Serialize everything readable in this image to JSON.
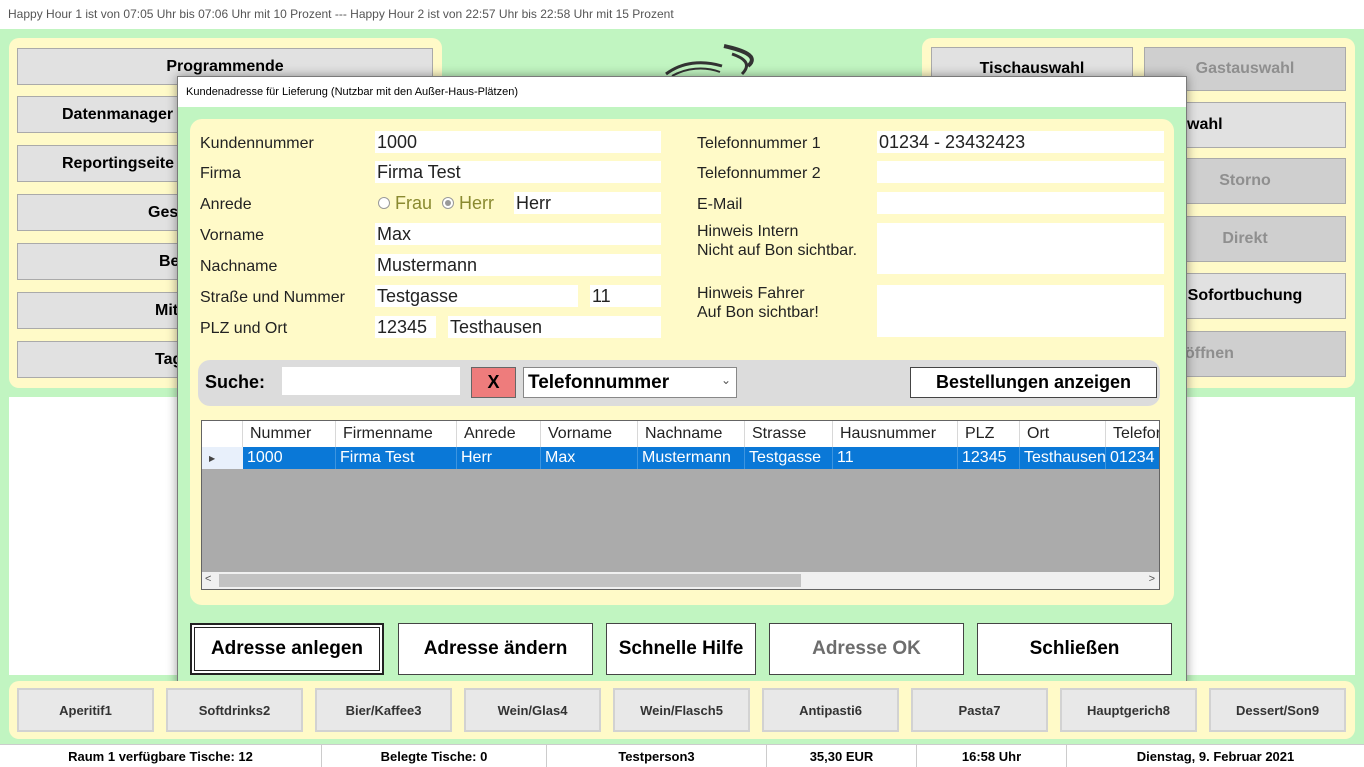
{
  "ticker": "Happy Hour 1 ist von 07:05 Uhr bis 07:06 Uhr mit 10 Prozent --- Happy Hour 2 ist von 22:57 Uhr bis 22:58 Uhr mit 15 Prozent",
  "left_menu": {
    "programmende": "Programmende",
    "datenmanager": "Datenmanager",
    "reportingseite": "Reportingseite",
    "gesamt": "Ges",
    "be": "Be",
    "mit": "Mit",
    "tag": "Tag"
  },
  "right_menu": {
    "tischauswahl": "Tischauswahl",
    "gastauswahl": "Gastauswahl",
    "wahl": "wahl",
    "storno": "Storno",
    "direkt": "Direkt",
    "sofortbuchung": "Sofortbuchung",
    "oeffnen": "öffnen"
  },
  "dialog": {
    "title": "Kundenadresse für Lieferung (Nutzbar mit den Außer-Haus-Plätzen)",
    "labels": {
      "kundennummer": "Kundennummer",
      "firma": "Firma",
      "anrede": "Anrede",
      "vorname": "Vorname",
      "nachname": "Nachname",
      "strasse": "Straße und Nummer",
      "plz_ort": "PLZ und Ort",
      "telefon1": "Telefonnummer 1",
      "telefon2": "Telefonnummer 2",
      "email": "E-Mail",
      "hinweis_intern_1": "Hinweis Intern",
      "hinweis_intern_2": "Nicht auf Bon sichtbar.",
      "hinweis_fahrer_1": "Hinweis Fahrer",
      "hinweis_fahrer_2": "Auf Bon sichtbar!"
    },
    "values": {
      "kundennummer": "1000",
      "firma": "Firma Test",
      "radio_frau": "Frau",
      "radio_herr": "Herr",
      "anrede_selected": "Herr",
      "anrede": "Herr",
      "vorname": "Max",
      "nachname": "Mustermann",
      "strasse": "Testgasse",
      "hausnummer": "11",
      "plz": "12345",
      "ort": "Testhausen",
      "telefon1": "01234 - 23432423",
      "telefon2": "",
      "email": "",
      "hinweis_intern": "",
      "hinweis_fahrer": ""
    },
    "search": {
      "label": "Suche:",
      "value": "",
      "clear": "X",
      "field_selected": "Telefonnummer",
      "show_orders": "Bestellungen anzeigen"
    },
    "grid": {
      "columns": [
        "Nummer",
        "Firmenname",
        "Anrede",
        "Vorname",
        "Nachname",
        "Strasse",
        "Hausnummer",
        "PLZ",
        "Ort",
        "Telefor"
      ],
      "rows": [
        [
          "1000",
          "Firma Test",
          "Herr",
          "Max",
          "Mustermann",
          "Testgasse",
          "11",
          "12345",
          "Testhausen",
          "01234"
        ]
      ]
    },
    "buttons": {
      "anlegen": "Adresse anlegen",
      "aendern": "Adresse ändern",
      "hilfe": "Schnelle Hilfe",
      "ok": "Adresse OK",
      "schliessen": "Schließen"
    }
  },
  "categories": [
    "Aperitif1",
    "Softdrinks2",
    "Bier/Kaffee3",
    "Wein/Glas4",
    "Wein/Flasch5",
    "Antipasti6",
    "Pasta7",
    "Hauptgerich8",
    "Dessert/Son9"
  ],
  "status": {
    "raum": "Raum 1 verfügbare Tische: 12",
    "belegt": "Belegte Tische: 0",
    "person": "Testperson3",
    "betrag": "35,30 EUR",
    "uhrzeit": "16:58 Uhr",
    "datum": "Dienstag, 9. Februar 2021"
  },
  "colors": {
    "background": "#c1f5c1",
    "panel": "#fffac8",
    "selection": "#0a78d7",
    "clear_button": "#ee7c7c"
  }
}
